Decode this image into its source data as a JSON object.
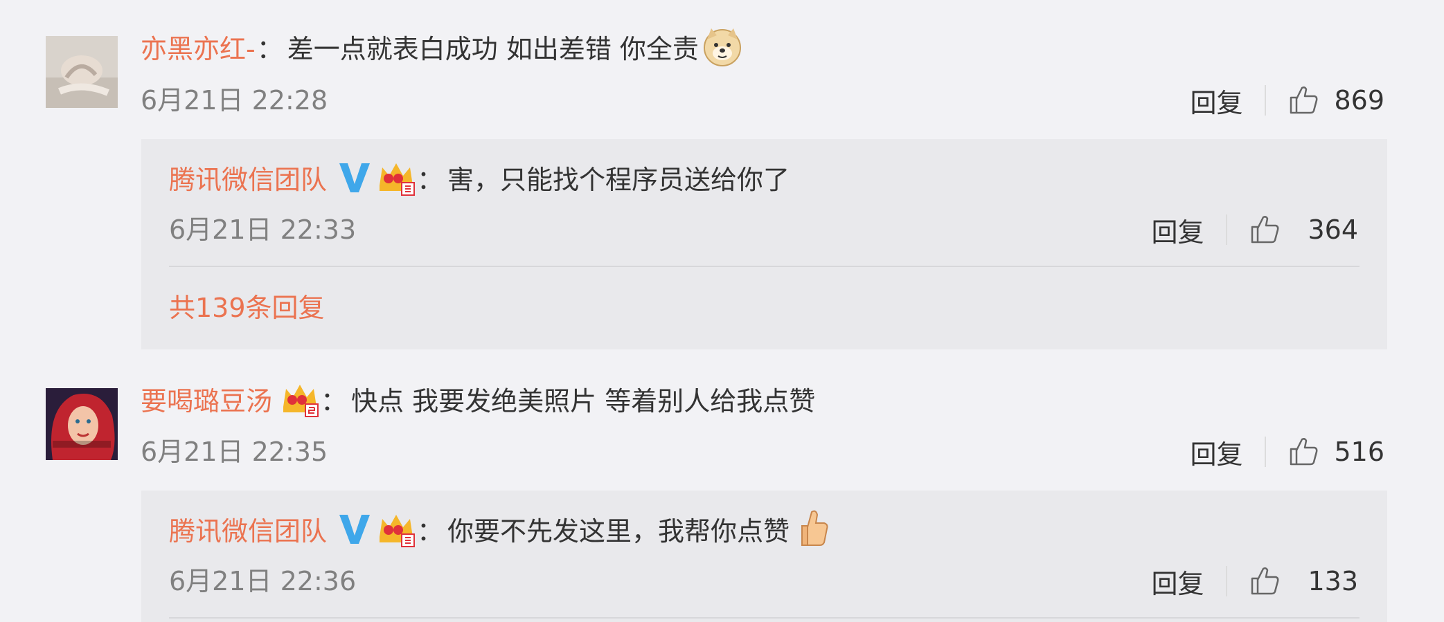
{
  "comments": [
    {
      "username": "亦黑亦红-",
      "separator": "：",
      "text": "差一点就表白成功  如出差错 你全责",
      "timestamp": "6月21日 22:28",
      "reply_label": "回复",
      "likes": "869",
      "reply": {
        "username": "腾讯微信团队",
        "separator": "：",
        "text": "害，只能找个程序员送给你了",
        "timestamp": "6月21日 22:33",
        "reply_label": "回复",
        "likes": "364",
        "more_replies": "共139条回复"
      }
    },
    {
      "username": "要喝璐豆汤",
      "separator": "：",
      "text": "快点 我要发绝美照片 等着别人给我点赞",
      "timestamp": "6月21日 22:35",
      "reply_label": "回复",
      "likes": "516",
      "reply": {
        "username": "腾讯微信团队",
        "separator": "：",
        "text": "你要不先发这里，我帮你点赞",
        "timestamp": "6月21日 22:36",
        "reply_label": "回复",
        "likes": "133"
      }
    }
  ],
  "colors": {
    "username": "#eb7350",
    "background": "#f2f2f5",
    "reply_background": "#e9e9ec",
    "timestamp": "#808080",
    "verified": "#3fa7ea"
  },
  "icons": [
    "like-icon",
    "verified-v-icon",
    "crown-badge-icon",
    "doge-emoji-icon",
    "thumbs-up-emoji-icon"
  ]
}
